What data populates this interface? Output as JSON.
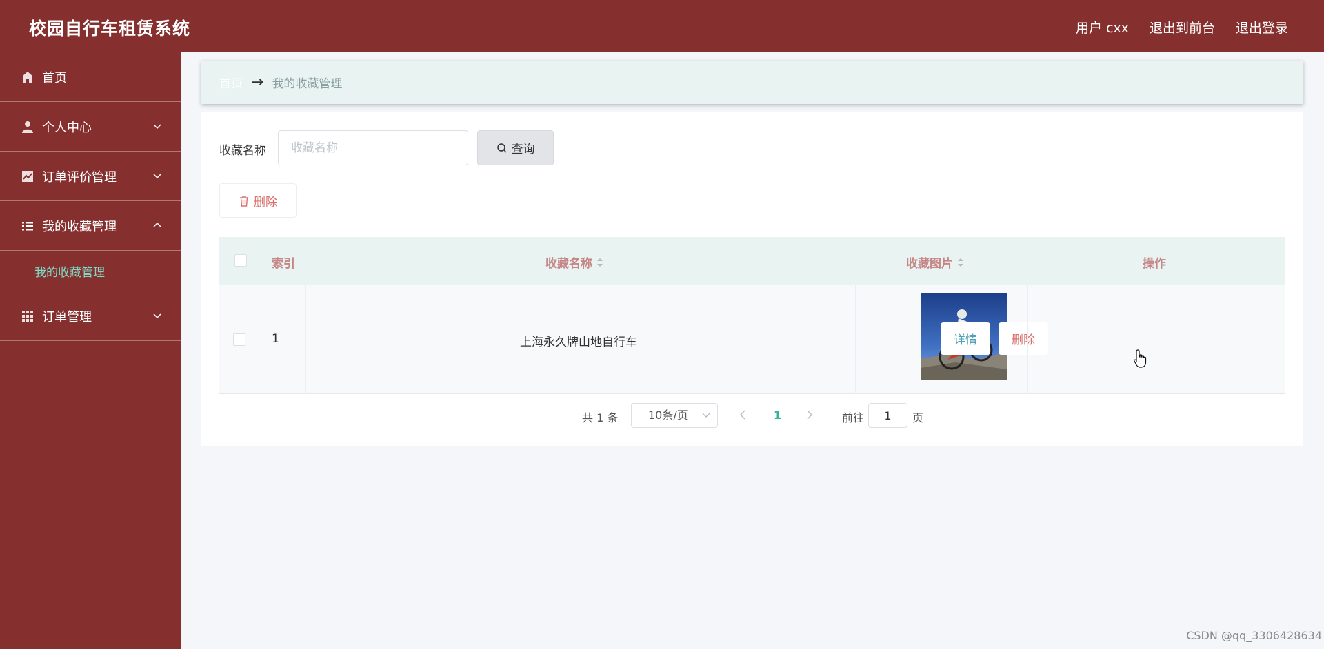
{
  "app": {
    "title": "校园自行车租赁系统"
  },
  "header": {
    "user_label": "用户 cxx",
    "front_label": "退出到前台",
    "logout_label": "退出登录"
  },
  "sidebar": {
    "items": [
      {
        "label": "首页",
        "icon": "home-icon"
      },
      {
        "label": "个人中心",
        "icon": "user-icon"
      },
      {
        "label": "订单评价管理",
        "icon": "chart-icon"
      },
      {
        "label": "我的收藏管理",
        "icon": "list-icon",
        "expanded": true,
        "sub": "我的收藏管理"
      },
      {
        "label": "订单管理",
        "icon": "grid-icon"
      }
    ]
  },
  "breadcrumb": {
    "home": "首页",
    "current": "我的收藏管理"
  },
  "search": {
    "label": "收藏名称",
    "placeholder": "收藏名称",
    "button": "查询"
  },
  "toolbar": {
    "delete_label": "删除"
  },
  "table": {
    "columns": [
      "索引",
      "收藏名称",
      "收藏图片",
      "操作"
    ],
    "rows": [
      {
        "index": "1",
        "name": "上海永久牌山地自行车",
        "detail": "详情",
        "delete": "删除"
      }
    ]
  },
  "pagination": {
    "total": "共 1 条",
    "page_size": "10条/页",
    "current_page": "1",
    "goto_label": "前往",
    "goto_value": "1",
    "page_suffix": "页"
  },
  "watermark": "CSDN @qq_3306428634",
  "colors": {
    "brand": "#85302f",
    "accent": "#2fb39a",
    "danger": "#d9706d",
    "header_text": "#c58686"
  }
}
